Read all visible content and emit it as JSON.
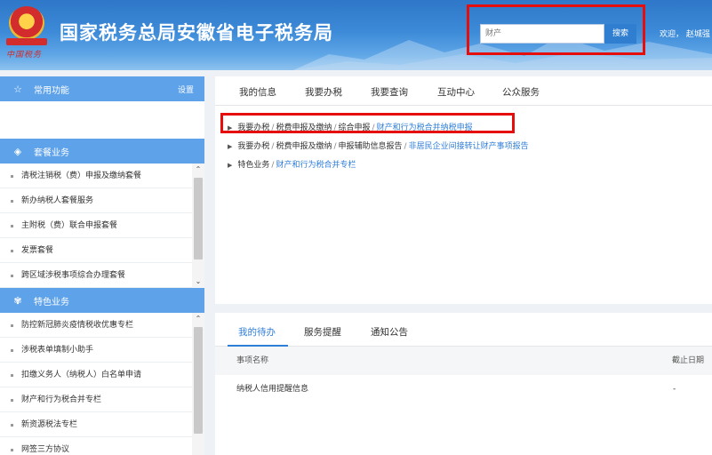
{
  "header": {
    "site_title": "国家税务总局安徽省电子税务局",
    "search_value": "财产",
    "search_button": "搜索",
    "welcome": "欢迎，  赵城强"
  },
  "sidebar": {
    "common": {
      "label": "常用功能",
      "settings": "设置",
      "icon": "star-icon"
    },
    "package": {
      "label": "套餐业务",
      "icon": "layers-icon",
      "items": [
        "清税注销税（费）申报及缴纳套餐",
        "新办纳税人套餐服务",
        "主附税（费）联合申报套餐",
        "发票套餐",
        "跨区域涉税事项综合办理套餐"
      ]
    },
    "special": {
      "label": "特色业务",
      "icon": "flower-icon",
      "items": [
        "防控新冠肺炎疫情税收优惠专栏",
        "涉税表单填制小助手",
        "扣缴义务人（纳税人）白名单申请",
        "财产和行为税合并专栏",
        "新资源税法专栏",
        "网签三方协议"
      ]
    }
  },
  "main": {
    "tabs": [
      "我的信息",
      "我要办税",
      "我要查询",
      "互动中心",
      "公众服务"
    ],
    "results": [
      {
        "path": [
          "我要办税",
          "税费申报及缴纳",
          "综合申报"
        ],
        "target": "财产和行为税合并纳税申报"
      },
      {
        "path": [
          "我要办税",
          "税费申报及缴纳",
          "申报辅助信息报告"
        ],
        "target": "非居民企业间接转让财产事项报告"
      },
      {
        "path": [
          "特色业务"
        ],
        "target": "财产和行为税合并专栏"
      }
    ]
  },
  "todo": {
    "tabs": [
      "我的待办",
      "服务提醒",
      "通知公告"
    ],
    "columns": [
      "事项名称",
      "截止日期"
    ],
    "rows": [
      {
        "name": "纳税人信用提醒信息",
        "deadline": "-"
      }
    ]
  }
}
